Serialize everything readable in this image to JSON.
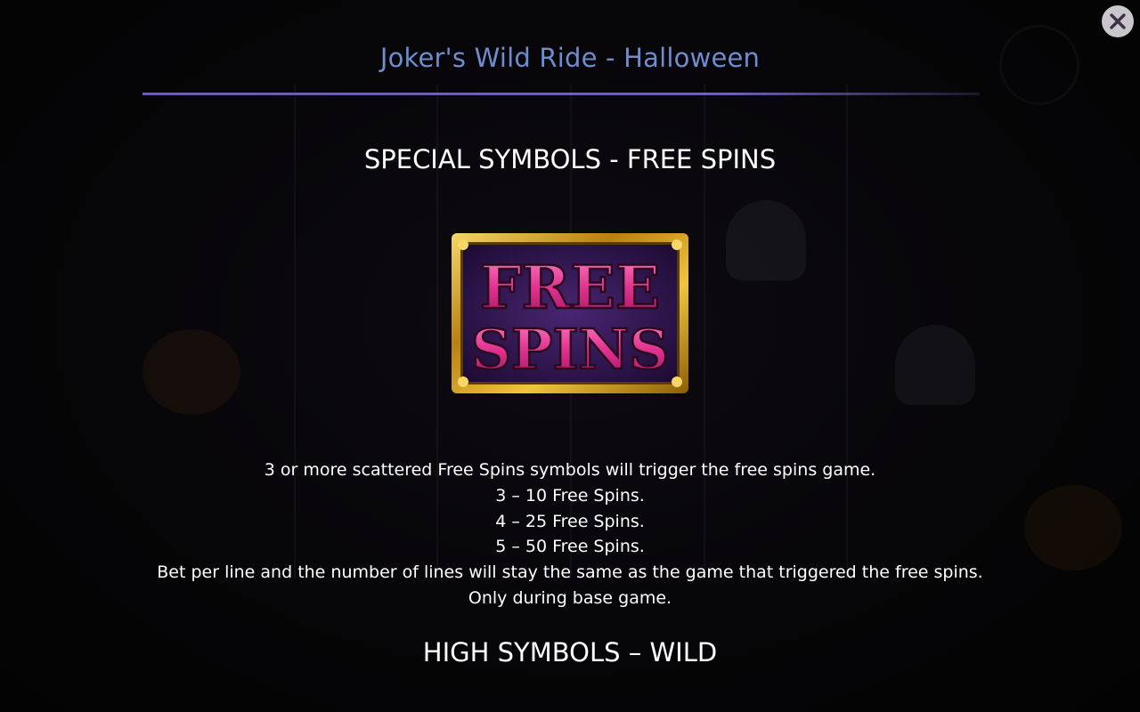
{
  "dialog": {
    "title": "Joker's Wild Ride - Halloween",
    "close_icon": "close-icon",
    "accent_color": "#6e8dd0"
  },
  "sections": [
    {
      "heading": "SPECIAL SYMBOLS - FREE SPINS",
      "symbol": {
        "line1": "FREE",
        "line2": "SPINS",
        "colors": {
          "text": "#e0338f",
          "frame": "#d9a520",
          "background": "#3a1a5a"
        }
      },
      "description": [
        "3 or more scattered Free Spins symbols will trigger the free spins game.",
        "3 – 10 Free Spins.",
        "4 – 25 Free Spins.",
        "5 – 50 Free Spins.",
        "Bet per line and the number of lines will stay the same as the game that triggered the free spins.",
        "Only during base game."
      ]
    },
    {
      "heading": "HIGH SYMBOLS – WILD"
    }
  ]
}
